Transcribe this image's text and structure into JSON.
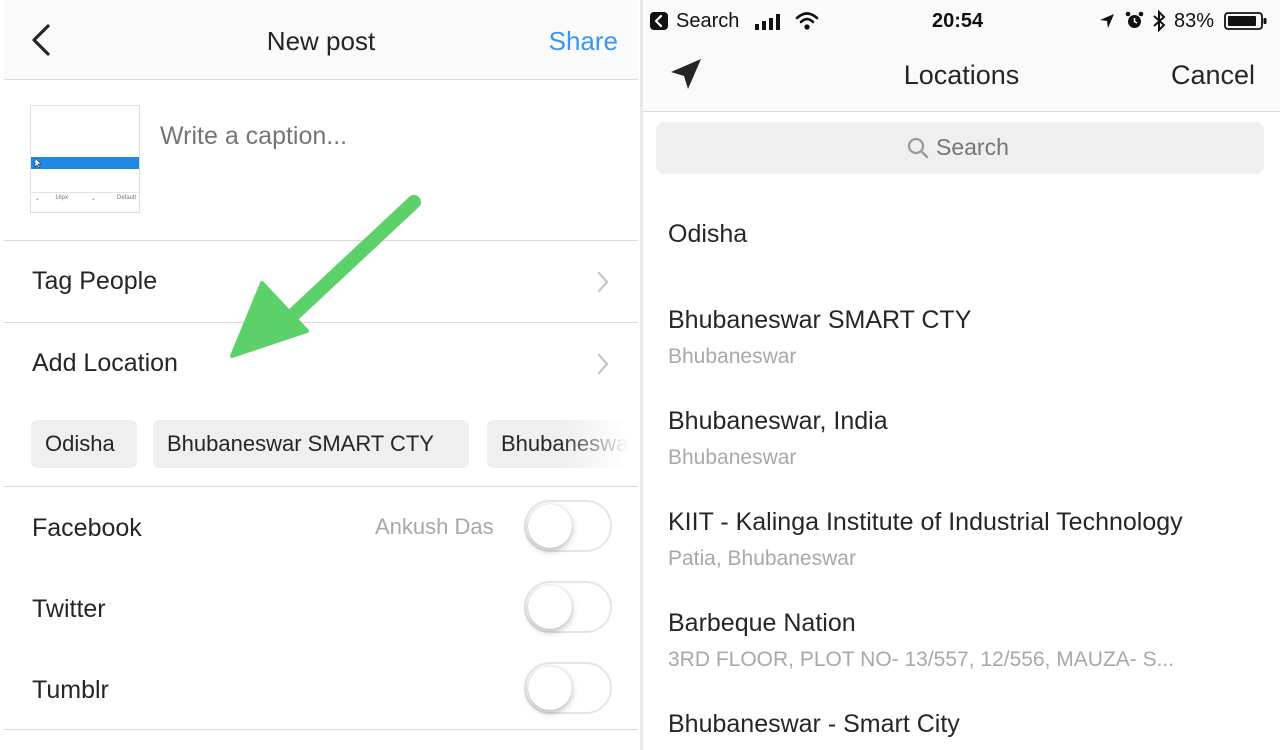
{
  "left": {
    "header": {
      "title": "New post",
      "share_label": "Share"
    },
    "caption": {
      "placeholder": "Write a caption...",
      "value": ""
    },
    "thumbnail_text": {
      "size": "16px",
      "font": "Default"
    },
    "rows": {
      "tag_people": "Tag People",
      "add_location": "Add Location"
    },
    "location_chips": [
      "Odisha",
      "Bhubaneswar SMART CTY",
      "Bhubaneswar"
    ],
    "share_to": {
      "facebook": {
        "label": "Facebook",
        "account": "Ankush Das",
        "on": false
      },
      "twitter": {
        "label": "Twitter",
        "on": false
      },
      "tumblr": {
        "label": "Tumblr",
        "on": false
      }
    },
    "arrow_color": "#5cd16a"
  },
  "right": {
    "status_bar": {
      "back_app": "Search",
      "time": "20:54",
      "battery": "83%"
    },
    "header": {
      "title": "Locations",
      "cancel_label": "Cancel"
    },
    "search": {
      "placeholder": "Search"
    },
    "locations": [
      {
        "name": "Odisha",
        "sub": ""
      },
      {
        "name": "Bhubaneswar SMART CTY",
        "sub": "Bhubaneswar"
      },
      {
        "name": "Bhubaneswar, India",
        "sub": "Bhubaneswar"
      },
      {
        "name": "KIIT - Kalinga Institute of Industrial Technology",
        "sub": "Patia, Bhubaneswar"
      },
      {
        "name": "Barbeque Nation",
        "sub": "3RD FLOOR, PLOT NO- 13/557, 12/556, MAUZA- S..."
      },
      {
        "name": "Bhubaneswar - Smart City",
        "sub": ""
      }
    ]
  },
  "colors": {
    "accent": "#3897f0",
    "text": "#262626",
    "muted": "#a8a8a8",
    "chip_bg": "#efefef"
  }
}
